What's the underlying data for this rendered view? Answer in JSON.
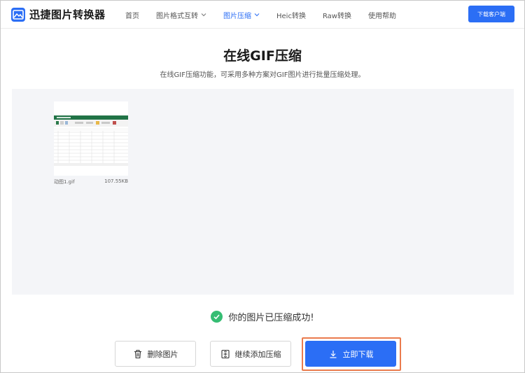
{
  "header": {
    "logo_text": "迅捷图片转换器",
    "nav": [
      {
        "label": "首页",
        "active": false,
        "dropdown": false
      },
      {
        "label": "图片格式互转",
        "active": false,
        "dropdown": true
      },
      {
        "label": "图片压缩",
        "active": true,
        "dropdown": true
      },
      {
        "label": "Heic转换",
        "active": false,
        "dropdown": false
      },
      {
        "label": "Raw转换",
        "active": false,
        "dropdown": false
      },
      {
        "label": "使用帮助",
        "active": false,
        "dropdown": false
      }
    ],
    "download_client_label": "下载客户端"
  },
  "main": {
    "title": "在线GIF压缩",
    "subtitle": "在线GIF压缩功能，可采用多种方案对GIF图片进行批量压缩处理。"
  },
  "files": [
    {
      "name": "动图1.gif",
      "size": "107.55KB"
    }
  ],
  "status": {
    "success_text": "你的图片已压缩成功!"
  },
  "actions": {
    "delete_label": "删除图片",
    "continue_label": "继续添加压缩",
    "download_label": "立即下载"
  },
  "colors": {
    "accent": "#2b6ef5",
    "success": "#35bd73",
    "highlight": "#ea7b4d",
    "work_area_bg": "#f4f5f8"
  }
}
